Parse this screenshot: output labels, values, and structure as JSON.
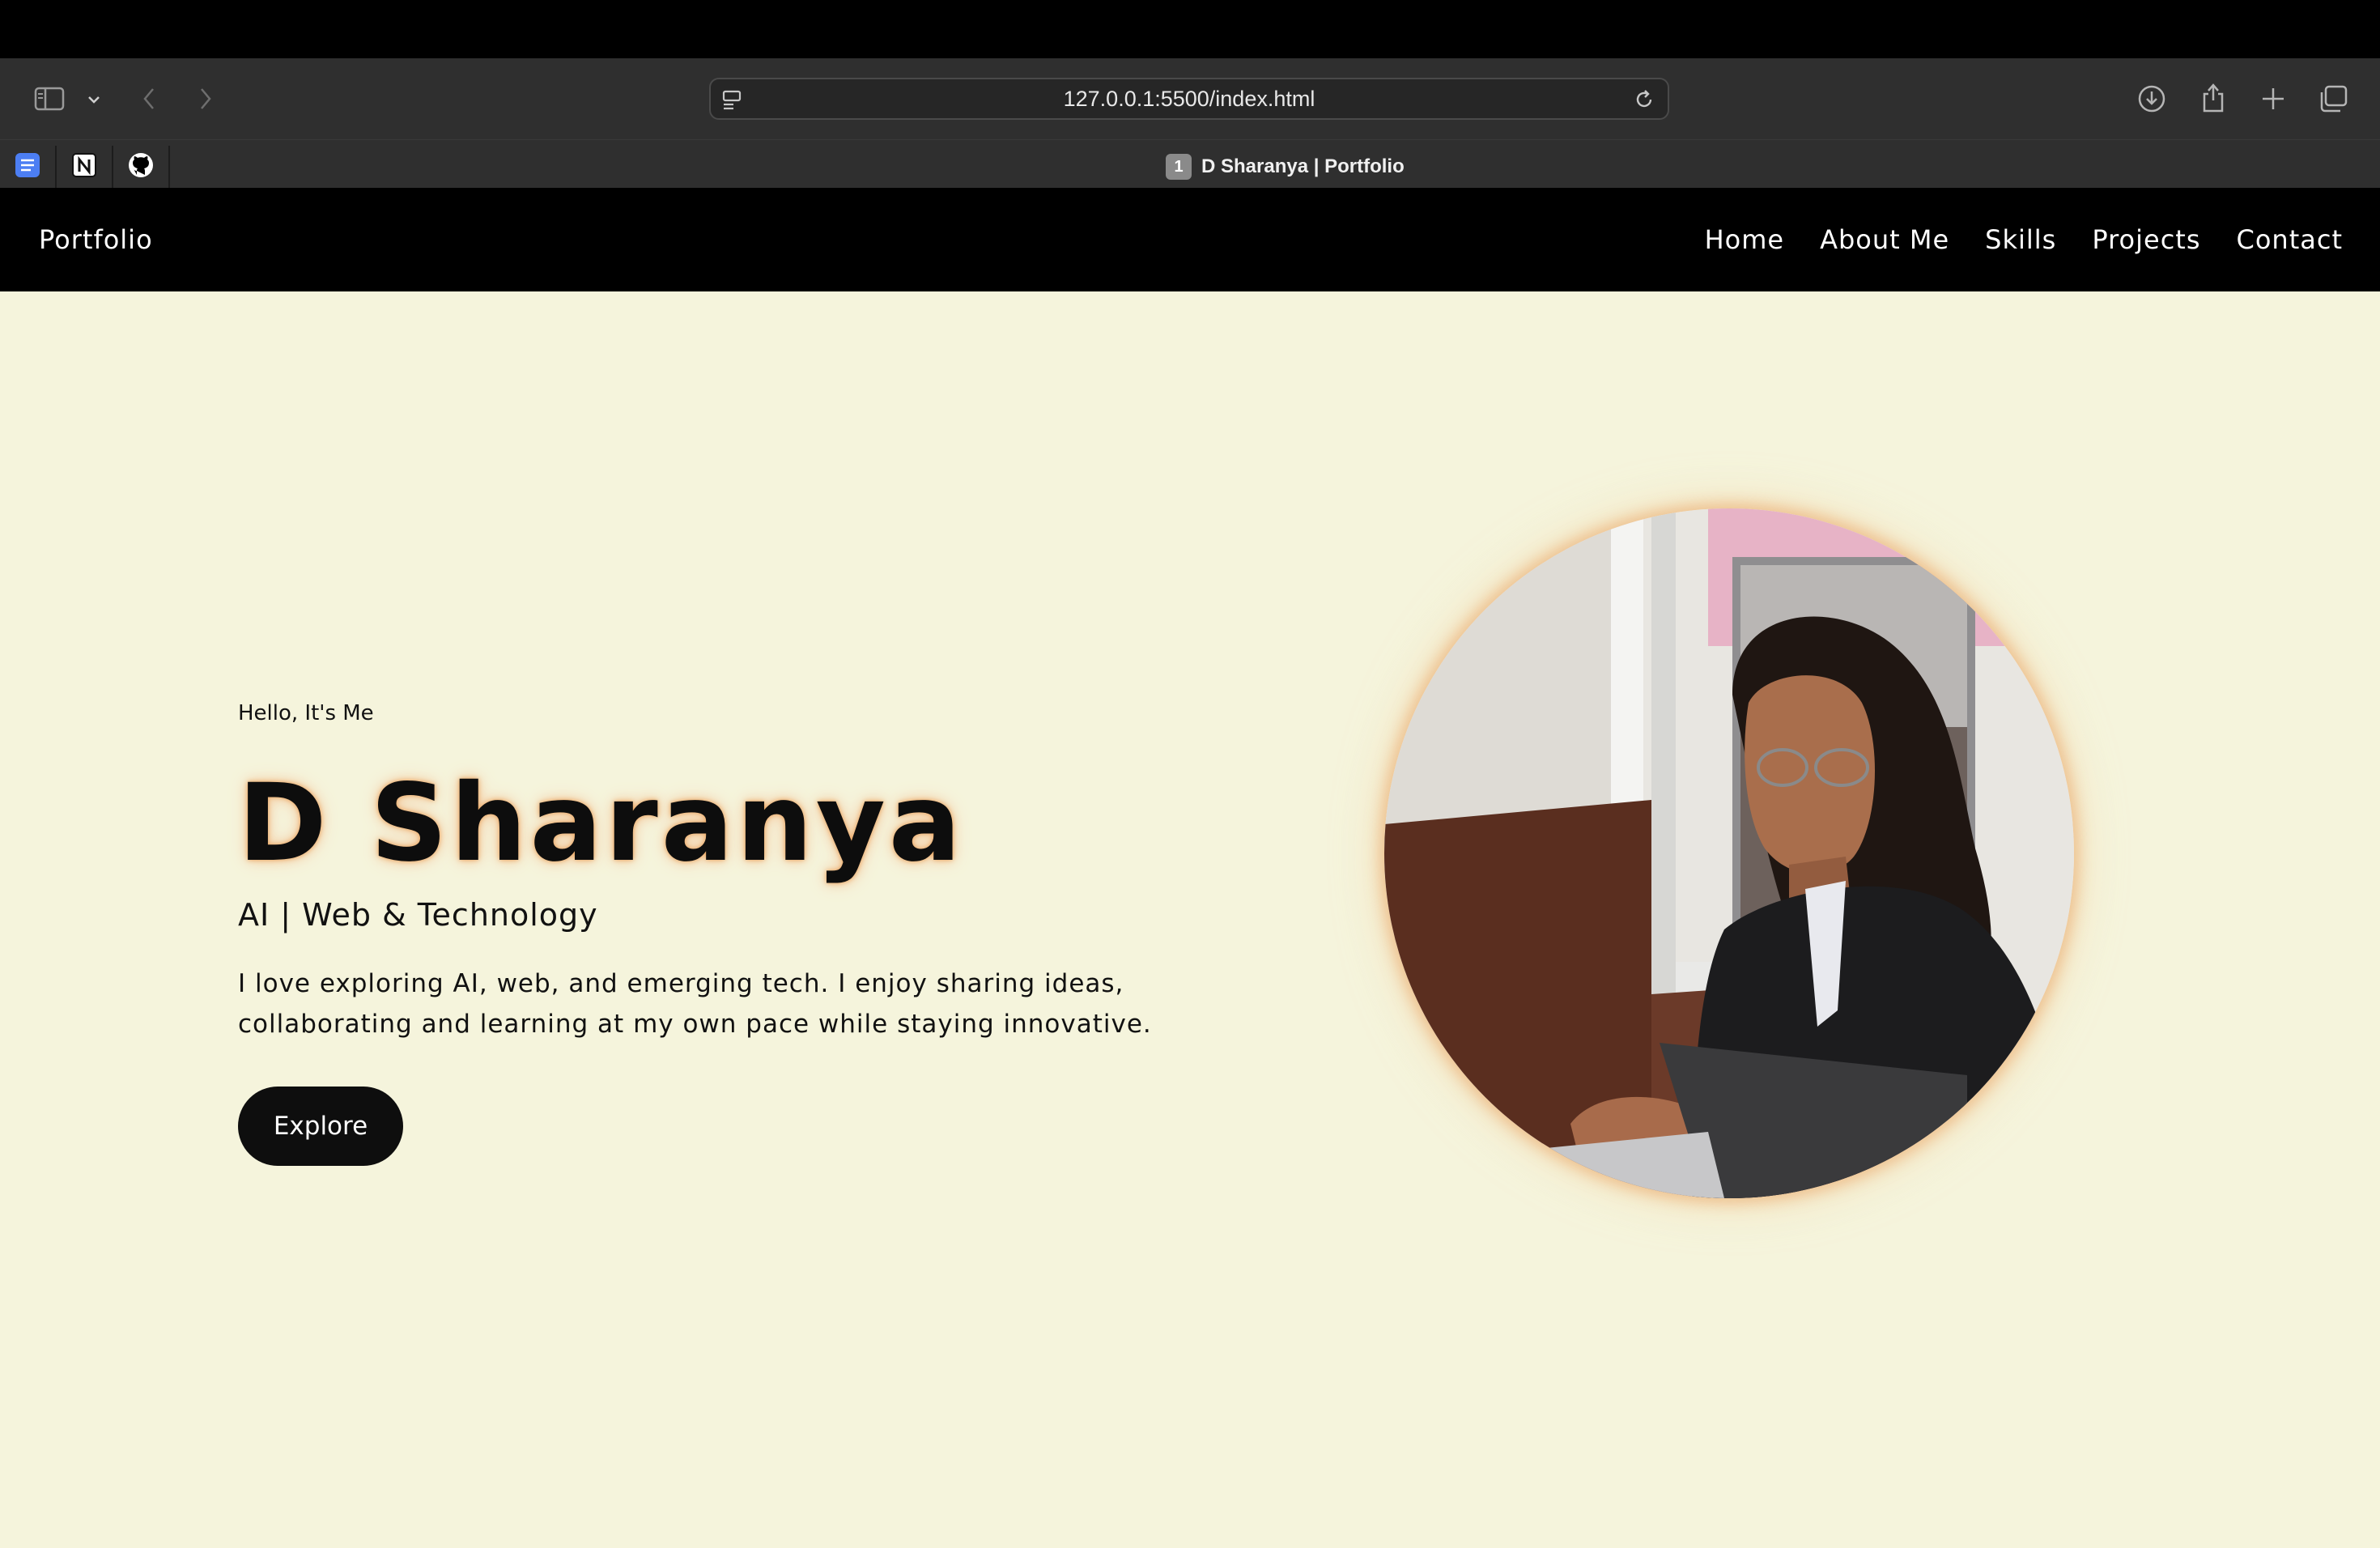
{
  "browser": {
    "url": "127.0.0.1:5500/index.html",
    "tab_title": "D Sharanya | Portfolio",
    "tab_badge": "1",
    "icons": [
      "sidebar-icon",
      "chevron-down-icon",
      "back-icon",
      "forward-icon",
      "page-menu-icon",
      "reload-icon",
      "download-icon",
      "share-icon",
      "new-tab-icon",
      "tab-overview-icon"
    ],
    "pinned_tabs": [
      "docs-icon",
      "notion-icon",
      "github-icon"
    ]
  },
  "nav": {
    "brand": "Portfolio",
    "links": [
      "Home",
      "About Me",
      "Skills",
      "Projects",
      "Contact"
    ]
  },
  "hero": {
    "kicker": "Hello, It's Me",
    "name": "D Sharanya",
    "role": "AI | Web & Technology",
    "description": "I love exploring AI, web, and emerging tech. I enjoy sharing ideas, collaborating and learning at my own pace while staying innovative.",
    "button": "Explore"
  },
  "colors": {
    "page_bg": "#f5f4dc",
    "navbar_bg": "#000000",
    "name_glow": "#e9a25a",
    "button_bg": "#0e0e0e"
  }
}
